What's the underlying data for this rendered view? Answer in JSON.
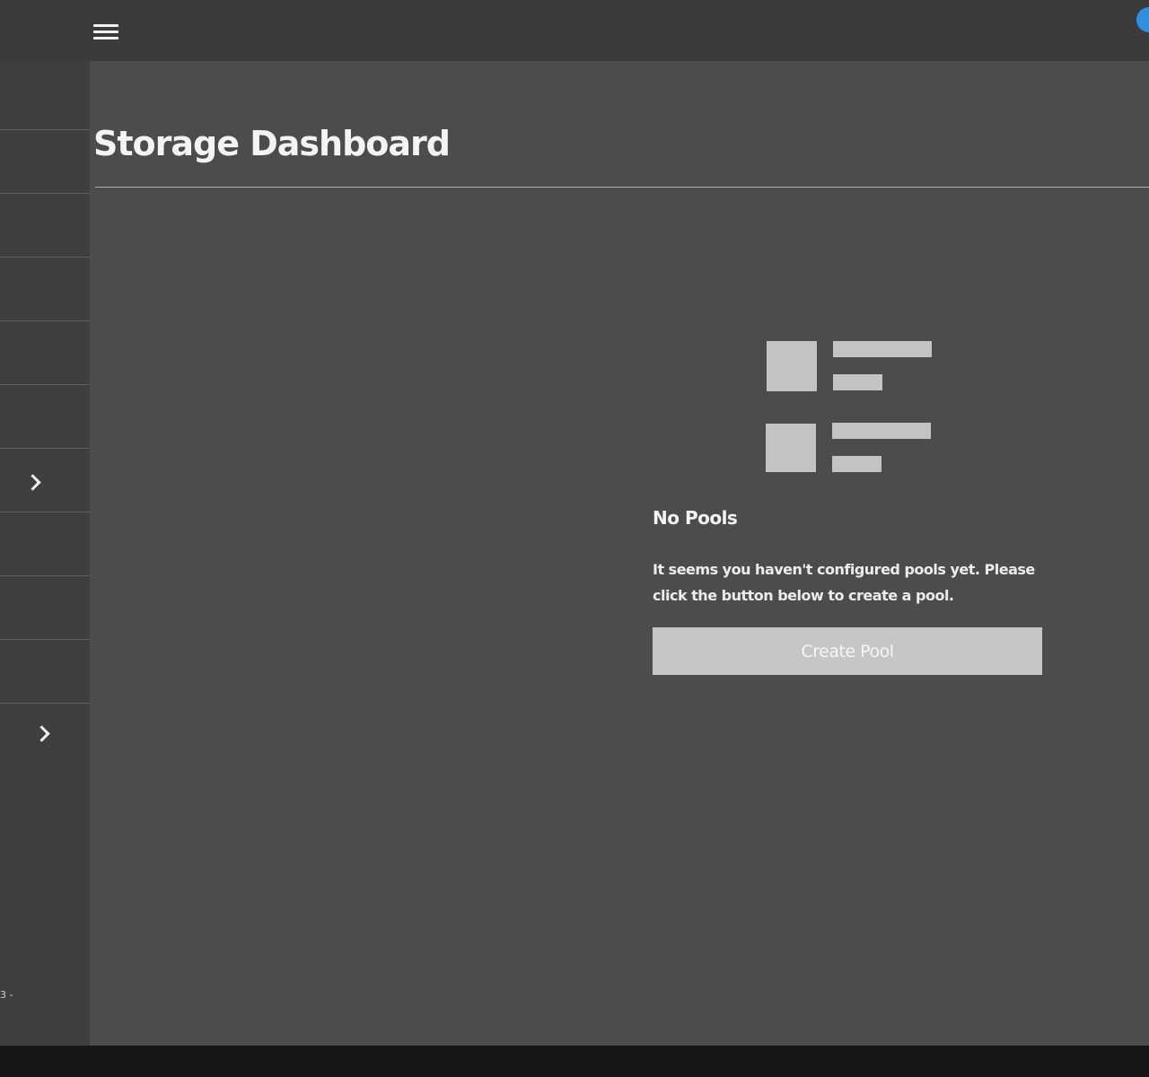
{
  "header": {
    "menu_icon": "hamburger-menu-icon"
  },
  "sidebar": {
    "items": [
      {
        "has_chevron": false
      },
      {
        "has_chevron": false
      },
      {
        "has_chevron": false
      },
      {
        "has_chevron": false
      },
      {
        "has_chevron": false
      },
      {
        "has_chevron": true,
        "chevron_icon": "chevron-right-icon"
      },
      {
        "has_chevron": false
      },
      {
        "has_chevron": false
      },
      {
        "has_chevron": false
      },
      {
        "has_chevron": true,
        "chevron_icon": "chevron-right-icon"
      }
    ],
    "footer_text": "3 -"
  },
  "main": {
    "title": "Storage Dashboard",
    "empty_state": {
      "icon": "empty-list-icon",
      "title": "No Pools",
      "message": "It seems you haven't configured pools yet. Please click the button below to create a pool.",
      "button_label": "Create Pool"
    }
  },
  "colors": {
    "background": "#4b4c4b",
    "topbar": "#3a3b3a",
    "sidebar": "#3e3f3e",
    "placeholder_blocks": "#c3c3c3",
    "button": "#c6c6c6",
    "corner_badge": "#2f8fe0"
  }
}
